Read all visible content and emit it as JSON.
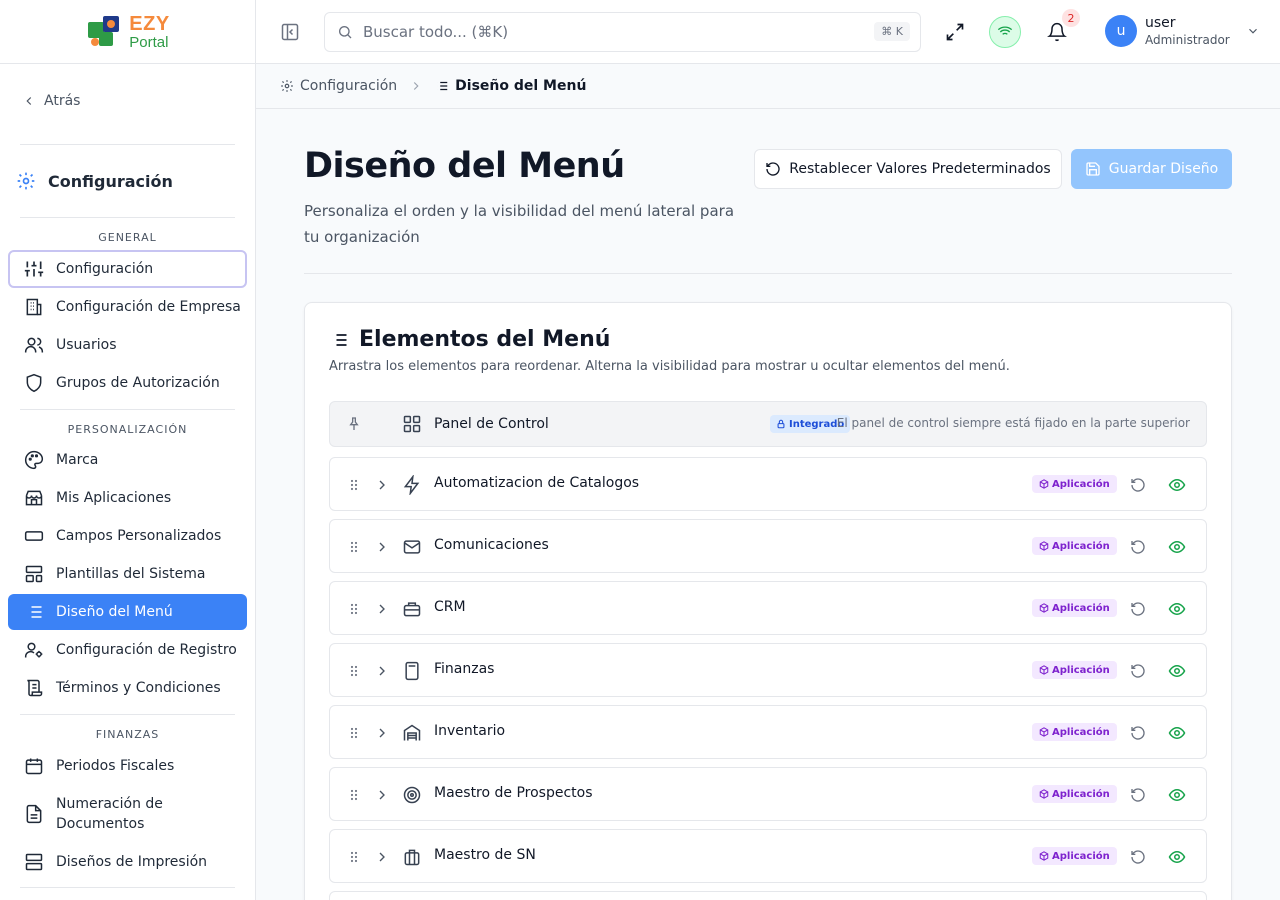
{
  "brand": {
    "ezy": "EZY",
    "portal": "Portal"
  },
  "sidebar": {
    "back": "Atrás",
    "section_title": "Configuración",
    "groups": [
      {
        "label": "GENERAL",
        "items": [
          "Configuración",
          "Configuración de Empresa",
          "Usuarios",
          "Grupos de Autorización"
        ]
      },
      {
        "label": "PERSONALIZACIÓN",
        "items": [
          "Marca",
          "Mis Aplicaciones",
          "Campos Personalizados",
          "Plantillas del Sistema",
          "Diseño del Menú",
          "Configuración de Registro",
          "Términos y Condiciones"
        ]
      },
      {
        "label": "FINANZAS",
        "items": [
          "Periodos Fiscales",
          "Numeración de Documentos",
          "Diseños de Impresión"
        ]
      }
    ]
  },
  "topbar": {
    "search_placeholder": "Buscar todo... (⌘K)",
    "shortcut": "⌘ K",
    "notifications": "2",
    "user": {
      "initial": "u",
      "name": "user",
      "role": "Administrador"
    }
  },
  "breadcrumb": {
    "parent": "Configuración",
    "current": "Diseño del Menú"
  },
  "page": {
    "title": "Diseño del Menú",
    "subtitle": "Personaliza el orden y la visibilidad del menú lateral para tu organización",
    "reset_label": "Restablecer Valores Predeterminados",
    "save_label": "Guardar Diseño"
  },
  "card": {
    "title": "Elementos del Menú",
    "subtitle": "Arrastra los elementos para reordenar. Alterna la visibilidad para mostrar u ocultar elementos del menú.",
    "pinned": {
      "name": "Panel de Control",
      "badge": "Integrado",
      "note": "El panel de control siempre está fijado en la parte superior"
    },
    "app_badge": "Aplicación",
    "items": [
      "Automatizacion de Catalogos",
      "Comunicaciones",
      "CRM",
      "Finanzas",
      "Inventario",
      "Maestro de Prospectos",
      "Maestro de SN"
    ]
  },
  "colors": {
    "accent": "#3b82f6",
    "active_nav": "#3b82f6",
    "save_disabled": "#93c5fd",
    "app_badge": "#7e22ce",
    "visible_eye": "#16a34a"
  }
}
